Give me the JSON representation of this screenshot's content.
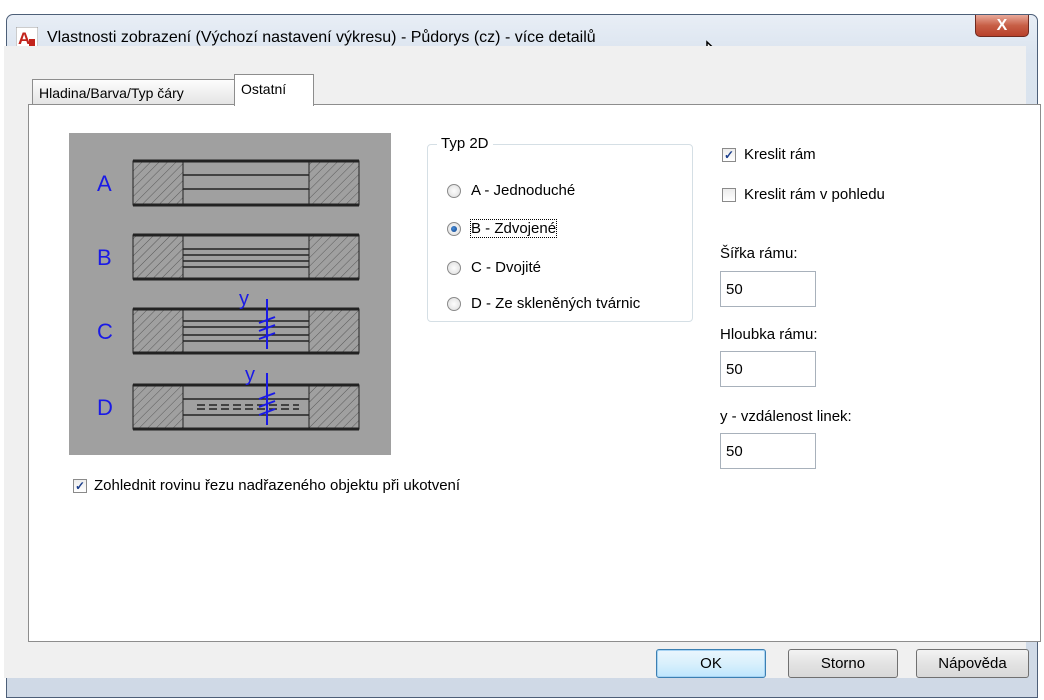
{
  "window": {
    "title": "Vlastnosti zobrazení (Výchozí nastavení výkresu) - Půdorys (cz) - více detailů",
    "close_label": "X"
  },
  "tabs": [
    {
      "label": "Hladina/Barva/Typ čáry"
    },
    {
      "label": "Ostatní",
      "active": true
    }
  ],
  "preview": {
    "row_labels": [
      "A",
      "B",
      "C",
      "D"
    ],
    "y_labels": [
      "y",
      "y"
    ],
    "label_color": "#1a1ae6"
  },
  "typ2d": {
    "title": "Typ 2D",
    "options": [
      {
        "label": "A - Jednoduché",
        "checked": false
      },
      {
        "label": "B - Zdvojené",
        "checked": true
      },
      {
        "label": "C - Dvojité",
        "checked": false
      },
      {
        "label": "D - Ze skleněných tvárnic",
        "checked": false
      }
    ]
  },
  "right": {
    "kreslit_ram": {
      "label": "Kreslit rám",
      "checked": true
    },
    "kreslit_ram_pohled": {
      "label": "Kreslit rám v pohledu",
      "checked": false
    },
    "sirka": {
      "label": "Šířka rámu:",
      "value": "50"
    },
    "hloubka": {
      "label": "Hloubka rámu:",
      "value": "50"
    },
    "y_vzdalenost": {
      "label": "y - vzdálenost linek:",
      "value": "50"
    }
  },
  "bottom_checkbox": {
    "label": "Zohlednit rovinu řezu nadřazeného objektu při ukotvení",
    "checked": true
  },
  "buttons": {
    "ok": "OK",
    "storno": "Storno",
    "help": "Nápověda"
  }
}
